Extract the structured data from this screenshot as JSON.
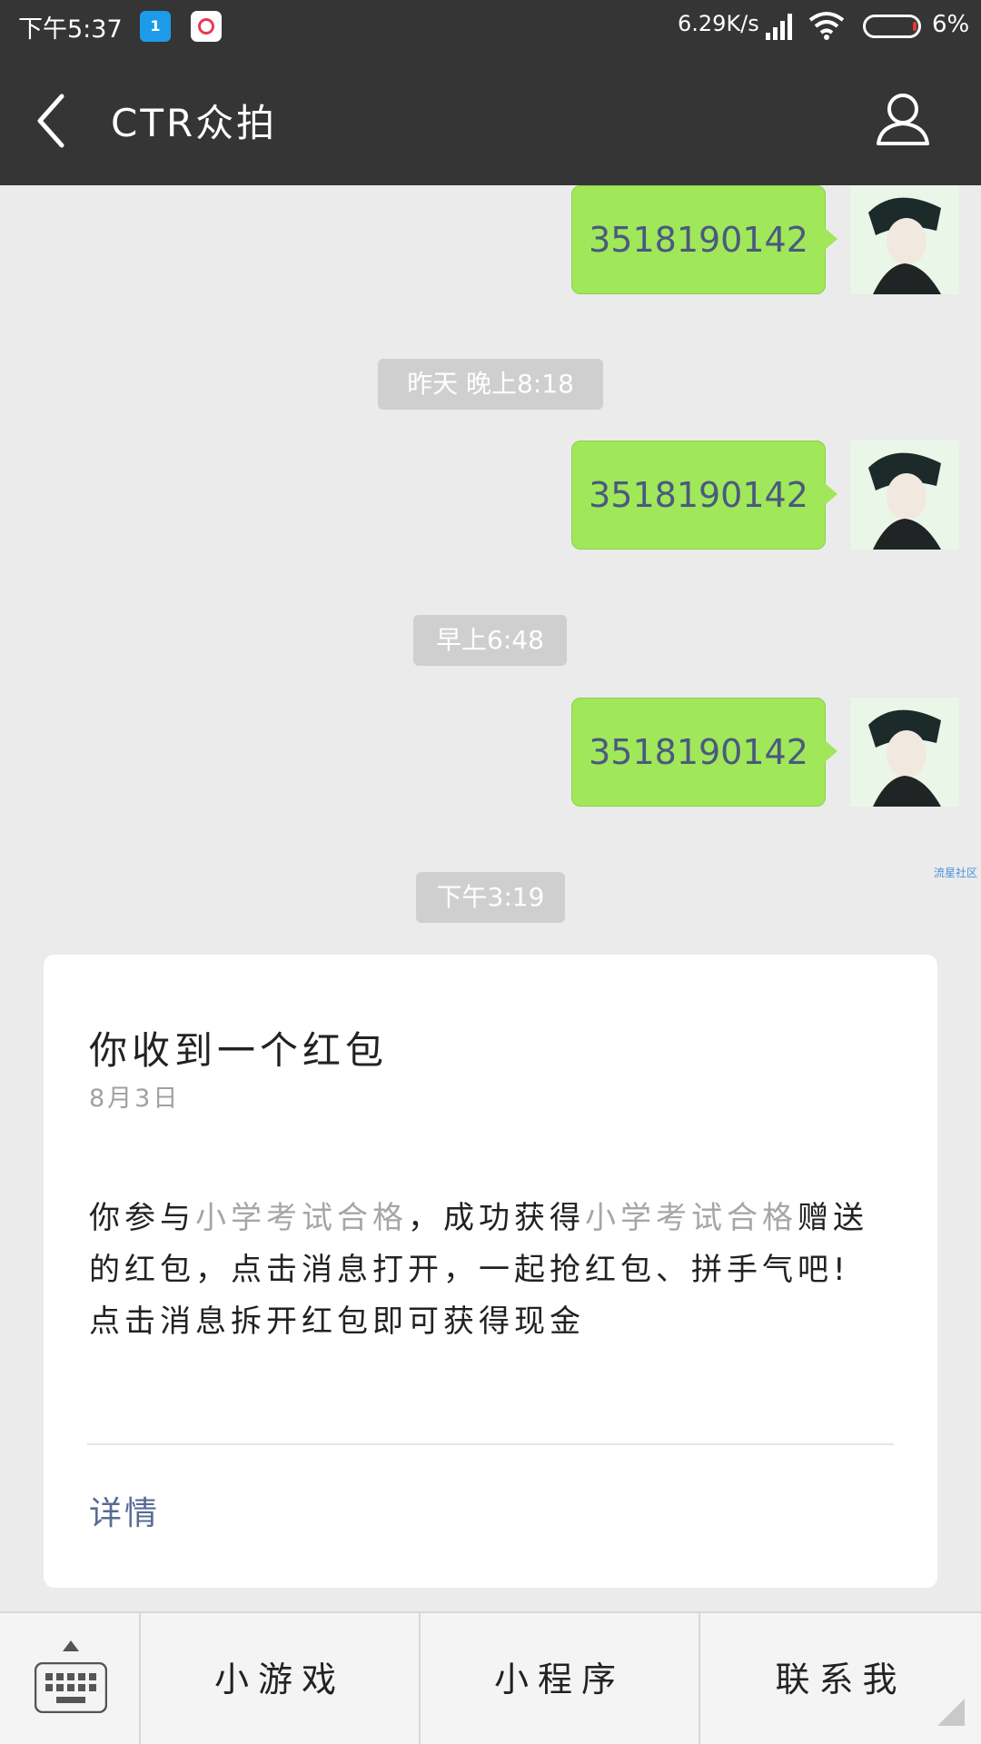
{
  "status_bar": {
    "time": "下午5:37",
    "app_icon_1": "1",
    "net_speed": "6.29K/s",
    "battery_percent": "6%",
    "icons": [
      "calendar-app-icon",
      "video-app-icon",
      "signal-icon",
      "wifi-icon",
      "battery-icon"
    ]
  },
  "header": {
    "title": "CTR众拍",
    "back_icon": "back-chevron-icon",
    "profile_icon": "person-icon"
  },
  "messages": [
    {
      "type": "sent",
      "text": "3518190142"
    },
    {
      "type": "timestamp",
      "text": "昨天 晚上8:18"
    },
    {
      "type": "sent",
      "text": "3518190142"
    },
    {
      "type": "timestamp",
      "text": "早上6:48"
    },
    {
      "type": "sent",
      "text": "3518190142"
    },
    {
      "type": "timestamp",
      "text": "下午3:19"
    }
  ],
  "watermark": "流星社区",
  "card": {
    "title": "你收到一个红包",
    "date": "8月3日",
    "body_part1": "你参与",
    "body_highlight1": "小学考试合格",
    "body_part2": "，成功获得",
    "body_highlight2": "小学考试合格",
    "body_part3": "赠送的红包，点击消息打开，一起抢红包、拼手气吧!",
    "body_line2": "点击消息拆开红包即可获得现金",
    "link": "详情"
  },
  "bottom_menu": {
    "items": [
      "小游戏",
      "小程序",
      "联系我"
    ]
  },
  "colors": {
    "header_bg": "#353535",
    "chat_bg": "#ebebeb",
    "bubble": "#a0e75a",
    "link": "#576b95"
  }
}
